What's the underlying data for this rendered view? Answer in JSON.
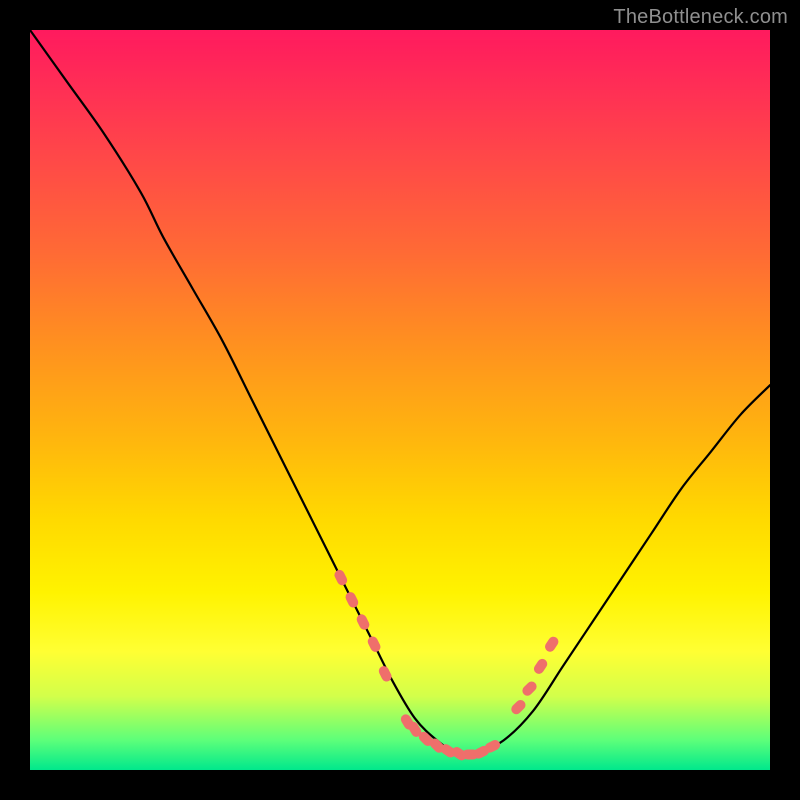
{
  "watermark": "TheBottleneck.com",
  "colors": {
    "background": "#000000",
    "curve": "#000000",
    "marker": "#ef6f6b",
    "gradient_stops": [
      "#ff1a5e",
      "#ff2f55",
      "#ff4a47",
      "#ff6a35",
      "#ff8f20",
      "#ffb50e",
      "#ffd900",
      "#fff300",
      "#ffff33",
      "#d3ff4a",
      "#5cff7a",
      "#00e88c"
    ]
  },
  "chart_data": {
    "type": "line",
    "title": "",
    "xlabel": "",
    "ylabel": "",
    "xlim": [
      0,
      100
    ],
    "ylim": [
      0,
      100
    ],
    "legend": false,
    "grid": false,
    "series": [
      {
        "name": "bottleneck-curve",
        "x": [
          0,
          5,
          10,
          15,
          18,
          22,
          26,
          30,
          34,
          38,
          42,
          46,
          49,
          52,
          55,
          58,
          60,
          64,
          68,
          72,
          76,
          80,
          84,
          88,
          92,
          96,
          100
        ],
        "y": [
          100,
          93,
          86,
          78,
          72,
          65,
          58,
          50,
          42,
          34,
          26,
          18,
          12,
          7,
          4,
          2,
          2,
          4,
          8,
          14,
          20,
          26,
          32,
          38,
          43,
          48,
          52
        ]
      }
    ],
    "markers": [
      {
        "name": "left-cluster",
        "points": [
          {
            "x": 42,
            "y": 26
          },
          {
            "x": 43.5,
            "y": 23
          },
          {
            "x": 45,
            "y": 20
          },
          {
            "x": 46.5,
            "y": 17
          },
          {
            "x": 48,
            "y": 13
          }
        ]
      },
      {
        "name": "bottom-cluster",
        "points": [
          {
            "x": 51,
            "y": 6.5
          },
          {
            "x": 52,
            "y": 5.5
          },
          {
            "x": 53.5,
            "y": 4.2
          },
          {
            "x": 55,
            "y": 3.3
          },
          {
            "x": 56.5,
            "y": 2.6
          },
          {
            "x": 58,
            "y": 2.2
          },
          {
            "x": 59.5,
            "y": 2.1
          },
          {
            "x": 61,
            "y": 2.4
          },
          {
            "x": 62.5,
            "y": 3.2
          }
        ]
      },
      {
        "name": "right-cluster",
        "points": [
          {
            "x": 66,
            "y": 8.5
          },
          {
            "x": 67.5,
            "y": 11
          },
          {
            "x": 69,
            "y": 14
          },
          {
            "x": 70.5,
            "y": 17
          }
        ]
      }
    ]
  }
}
